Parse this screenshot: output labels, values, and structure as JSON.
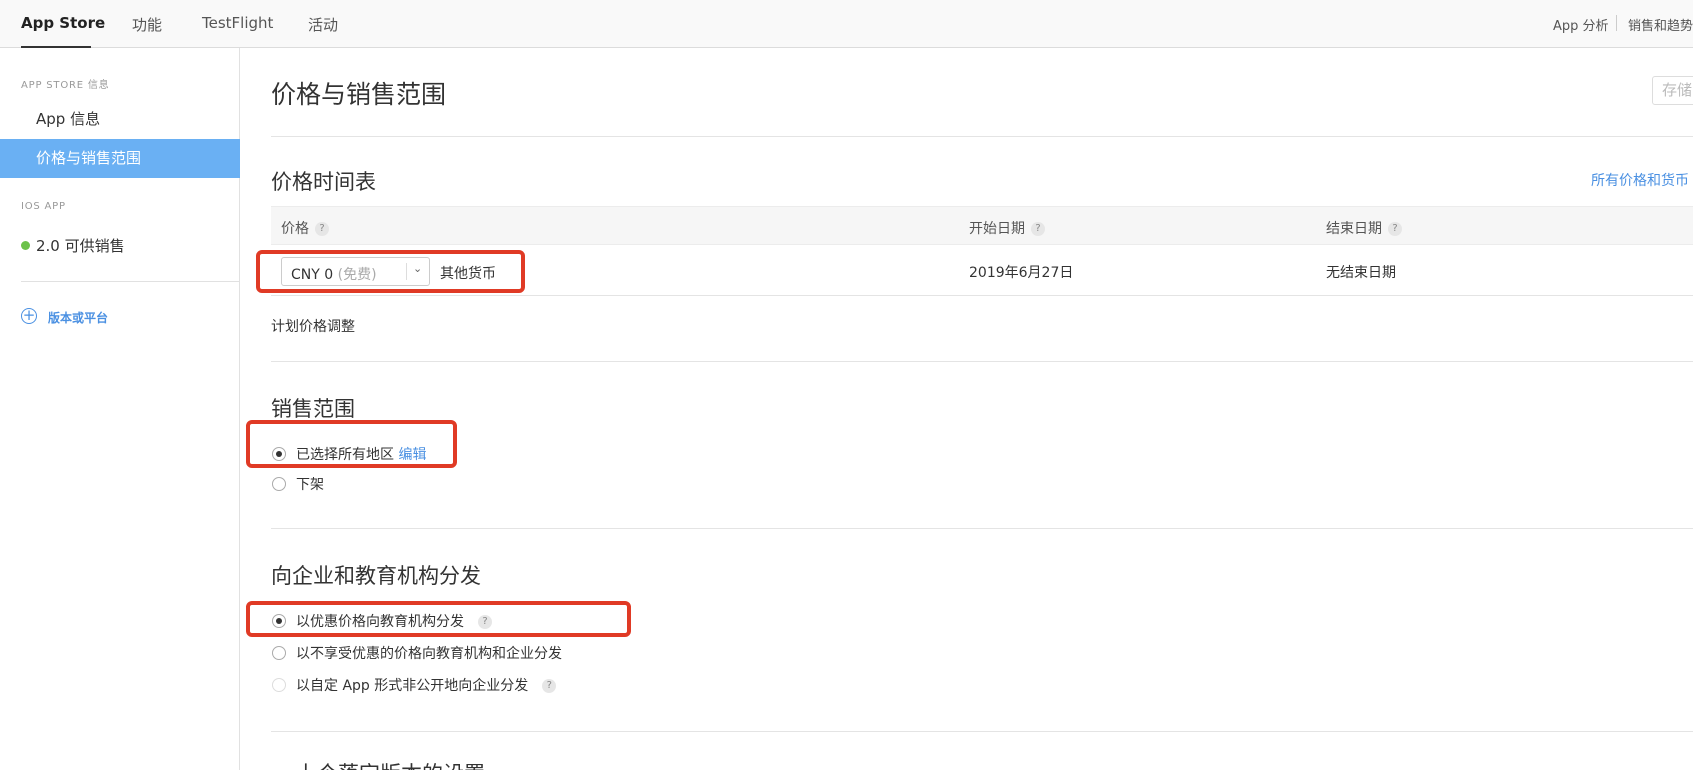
{
  "topnav": {
    "tabs": [
      "App Store",
      "功能",
      "TestFlight",
      "活动"
    ],
    "right_links": [
      "App 分析",
      "销售和趋势"
    ]
  },
  "sidebar": {
    "section_app_store": "APP STORE 信息",
    "items": [
      "App 信息",
      "价格与销售范围"
    ],
    "section_ios": "IOS APP",
    "version_item": "2.0 可供销售",
    "add_label": "版本或平台",
    "status_color": "#6cc24a"
  },
  "main": {
    "title": "价格与销售范围",
    "save_label": "存储",
    "price_schedule": {
      "title": "价格时间表",
      "all_prices_link": "所有价格和货币",
      "headers": [
        "价格",
        "开始日期",
        "结束日期"
      ],
      "help_glyph": "?",
      "price_value": "CNY 0",
      "price_note": "(免费)",
      "other_currency_link": "其他货币",
      "start_date": "2019年6月27日",
      "end_date": "无结束日期",
      "plan_link": "计划价格调整"
    },
    "availability": {
      "title": "销售范围",
      "option_all": "已选择所有地区",
      "edit_link": "编辑",
      "option_remove": "下架"
    },
    "distribution": {
      "title": "向企业和教育机构分发",
      "options": [
        "以优惠价格向教育机构分发",
        "以不享受优惠的价格向教育机构和企业分发",
        "以自定 App 形式非公开地向企业分发"
      ]
    },
    "next_section_title": "上个落定版本的设置"
  },
  "colors": {
    "accent": "#4a90e2",
    "sidebar_active": "#6ab0f3",
    "callout": "#e03a25"
  }
}
